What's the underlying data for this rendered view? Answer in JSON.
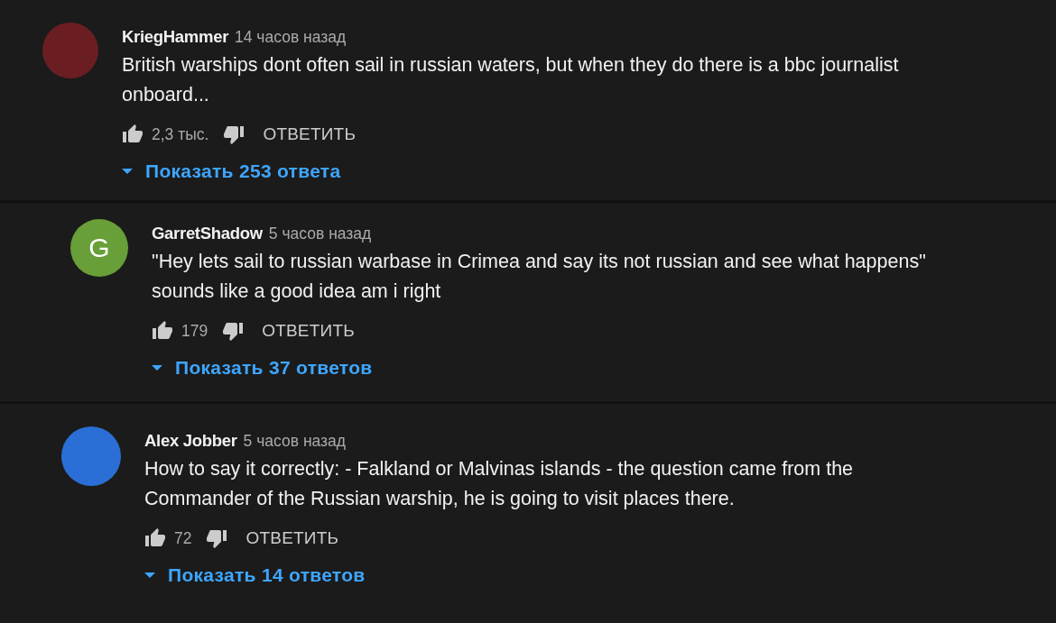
{
  "comments": [
    {
      "author": "KriegHammer",
      "time": "14 часов назад",
      "text": "British warships dont often sail in russian waters, but when they do there is a bbc journalist onboard...",
      "avatar": {
        "kind": "image"
      },
      "likes": "2,3 тыс.",
      "reply_label": "ОТВЕТИТЬ",
      "show_replies": "Показать 253 ответа"
    },
    {
      "author": "GarretShadow",
      "time": "5 часов назад",
      "text": "\"Hey lets sail to russian warbase in Crimea and say its not russian and see what happens\" sounds like a good idea am i right",
      "avatar": {
        "kind": "letter",
        "letter": "G",
        "color": "#689f38"
      },
      "likes": "179",
      "reply_label": "ОТВЕТИТЬ",
      "show_replies": "Показать 37 ответов"
    },
    {
      "author": "Alex Jobber",
      "time": "5 часов назад",
      "text": "How to say it correctly: - Falkland or Malvinas islands - the question came from the Commander of the Russian warship, he is going to visit places there.",
      "avatar": {
        "kind": "image"
      },
      "likes": "72",
      "reply_label": "ОТВЕТИТЬ",
      "show_replies": "Показать 14 ответов"
    }
  ]
}
